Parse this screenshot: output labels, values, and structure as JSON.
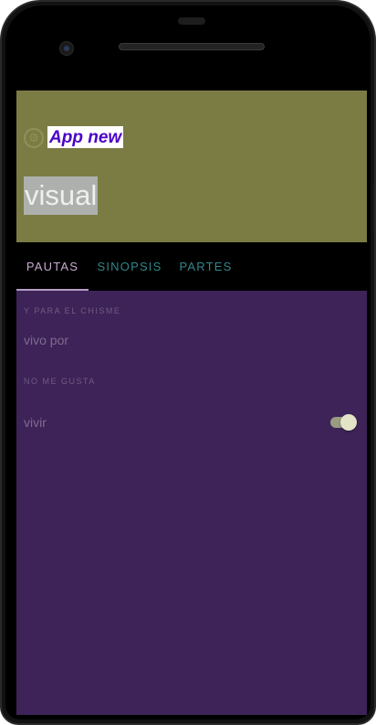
{
  "appbar": {
    "title": "App new",
    "subtitle": "visual",
    "icon": "settings-circle-icon",
    "background_color": "#7a7c44"
  },
  "tabs": [
    {
      "label": "PAUTAS",
      "active": true
    },
    {
      "label": "SINOPSIS",
      "active": false
    },
    {
      "label": "PARTES",
      "active": false
    }
  ],
  "content": {
    "background_color": "#3e2358",
    "sections": [
      {
        "header": "Y PARA EL CHISME",
        "items": [
          {
            "label": "vivo por"
          }
        ]
      },
      {
        "header": "NO ME GUSTA",
        "items": [
          {
            "label": "vivir",
            "toggle": true,
            "checked": true
          }
        ]
      }
    ]
  },
  "colors": {
    "accent": "#b49cc6",
    "tab_inactive": "#31878a",
    "title_text": "#4b00c8"
  }
}
